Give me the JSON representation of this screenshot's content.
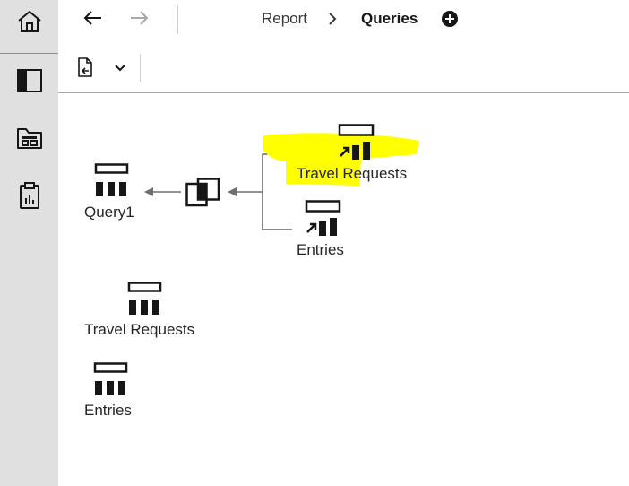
{
  "breadcrumb": {
    "parent": "Report",
    "current": "Queries"
  },
  "colors": {
    "highlight": "#ffff00",
    "rail": "#e0e0e0",
    "icon": "#161616"
  },
  "icons": {
    "rail": [
      "home-icon",
      "sidebar-panel-icon",
      "data-module-icon",
      "report-clipboard-icon"
    ],
    "nav": [
      "back-arrow-icon",
      "forward-arrow-icon",
      "chevron-right-icon",
      "add-circle-icon"
    ],
    "toolbar": [
      "document-import-icon",
      "chevron-down-icon"
    ]
  },
  "diagram": {
    "result_query": {
      "label": "Query1"
    },
    "join_operator": {
      "label": ""
    },
    "sources": [
      {
        "label": "Travel Requests",
        "highlighted": true
      },
      {
        "label": "Entries",
        "highlighted": false
      }
    ]
  },
  "query_list": [
    {
      "label": "Travel Requests"
    },
    {
      "label": "Entries"
    }
  ]
}
